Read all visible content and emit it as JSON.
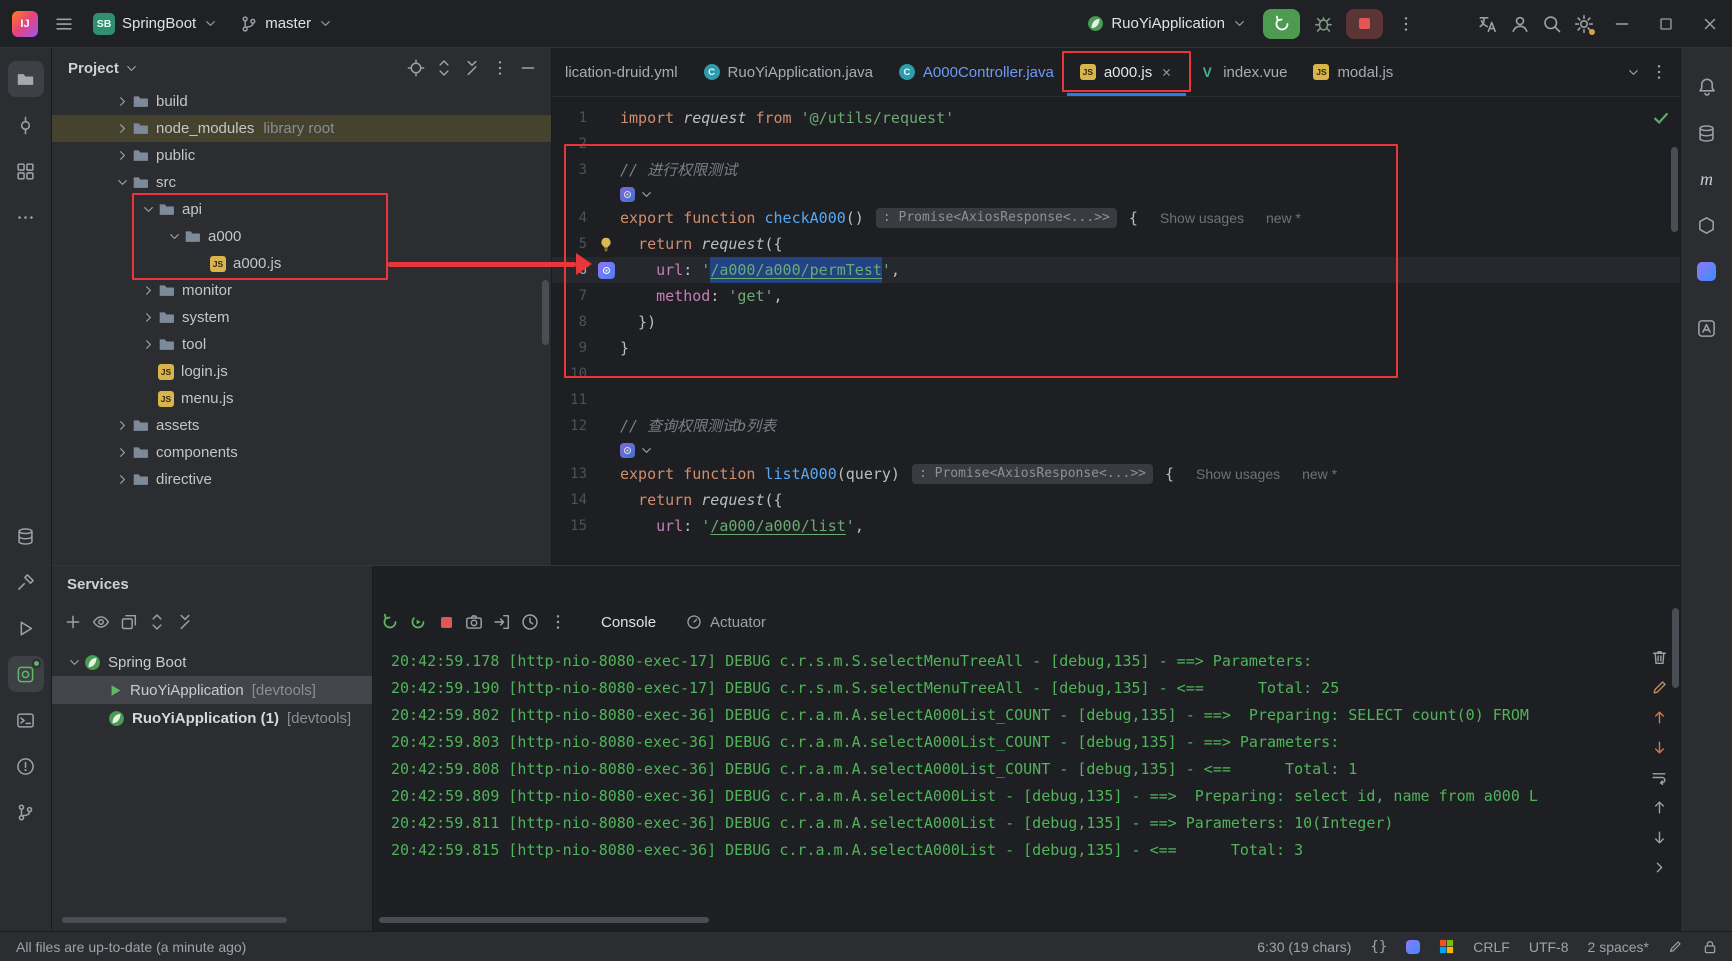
{
  "titlebar": {
    "logo_text": "IJ",
    "project_badge": "SB",
    "project_name": "SpringBoot",
    "branch_name": "master",
    "run_config_name": "RuoYiApplication"
  },
  "icons": {
    "titlebar_right": [
      "translate",
      "user",
      "search",
      "settings",
      "minimize",
      "maximize",
      "close"
    ],
    "left_strip_top": [
      "project",
      "commit",
      "structure",
      "more"
    ],
    "left_strip_bottom": [
      "database",
      "build",
      "run",
      "services",
      "terminal",
      "problems",
      "version-control"
    ],
    "right_strip": [
      "notifications",
      "database",
      "maven",
      "dependencies",
      "ai-plugin",
      "translation"
    ],
    "project_header": [
      "locate",
      "expand-all",
      "collapse-all",
      "kebab",
      "hide"
    ],
    "services_toolbar": [
      "add",
      "show",
      "open-new-tab",
      "expand-all",
      "collapse-all"
    ],
    "console_toolbar": [
      "rerun",
      "restart",
      "stop",
      "camera",
      "open-log",
      "history",
      "kebab"
    ],
    "console_right": [
      "trash",
      "pencil",
      "arrow-up-colored",
      "arrow-down-colored",
      "soft-wrap",
      "arrow-up",
      "arrow-down",
      "chevron-right"
    ]
  },
  "editor_tabs": [
    {
      "label": "lication-druid.yml",
      "icon": "none"
    },
    {
      "label": "RuoYiApplication.java",
      "icon": "class"
    },
    {
      "label": "A000Controller.java",
      "icon": "class",
      "modified": true
    },
    {
      "label": "a000.js",
      "icon": "js",
      "active": true,
      "closable": true
    },
    {
      "label": "index.vue",
      "icon": "vue"
    },
    {
      "label": "modal.js",
      "icon": "js"
    }
  ],
  "project_panel": {
    "title": "Project",
    "tree": [
      {
        "indent": 1,
        "chevron": "right",
        "icon": "folder",
        "label": "build"
      },
      {
        "indent": 1,
        "chevron": "right",
        "icon": "folder",
        "label": "node_modules",
        "suffix": "library root",
        "highlight": true
      },
      {
        "indent": 1,
        "chevron": "right",
        "icon": "folder",
        "label": "public"
      },
      {
        "indent": 1,
        "chevron": "down",
        "icon": "folder",
        "label": "src"
      },
      {
        "indent": 2,
        "chevron": "down",
        "icon": "folder",
        "label": "api"
      },
      {
        "indent": 3,
        "chevron": "down",
        "icon": "folder",
        "label": "a000"
      },
      {
        "indent": 4,
        "chevron": "none",
        "icon": "js",
        "label": "a000.js"
      },
      {
        "indent": 2,
        "chevron": "right",
        "icon": "folder",
        "label": "monitor"
      },
      {
        "indent": 2,
        "chevron": "right",
        "icon": "folder",
        "label": "system"
      },
      {
        "indent": 2,
        "chevron": "right",
        "icon": "folder",
        "label": "tool"
      },
      {
        "indent": 2,
        "chevron": "none",
        "icon": "js",
        "label": "login.js"
      },
      {
        "indent": 2,
        "chevron": "none",
        "icon": "js",
        "label": "menu.js"
      },
      {
        "indent": 1,
        "chevron": "right",
        "icon": "folder",
        "label": "assets"
      },
      {
        "indent": 1,
        "chevron": "right",
        "icon": "folder",
        "label": "components"
      },
      {
        "indent": 1,
        "chevron": "right",
        "icon": "folder",
        "label": "directive"
      }
    ]
  },
  "editor": {
    "rows": [
      {
        "n": 1,
        "segs": [
          [
            "kw",
            "import"
          ],
          [
            "def",
            " "
          ],
          [
            "ital",
            "request"
          ],
          [
            "def",
            " "
          ],
          [
            "kw",
            "from"
          ],
          [
            "def",
            " "
          ],
          [
            "str",
            "'@/utils/request'"
          ]
        ]
      },
      {
        "n": 2,
        "segs": []
      },
      {
        "n": 3,
        "segs": [
          [
            "cmt",
            "// 进行权限测试"
          ]
        ]
      },
      {
        "type": "actions"
      },
      {
        "n": 4,
        "segs": [
          [
            "kw",
            "export"
          ],
          [
            "def",
            " "
          ],
          [
            "kw",
            "function"
          ],
          [
            "def",
            " "
          ],
          [
            "fn",
            "checkA000"
          ],
          [
            "def",
            "() "
          ],
          [
            "pill",
            ": Promise<AxiosResponse<...>>"
          ],
          [
            "def",
            " {"
          ],
          [
            "hint",
            "Show usages"
          ],
          [
            "hint",
            "new *"
          ]
        ]
      },
      {
        "n": 5,
        "bulb": true,
        "segs": [
          [
            "def",
            "  "
          ],
          [
            "kw",
            "return"
          ],
          [
            "def",
            " "
          ],
          [
            "ital",
            "request"
          ],
          [
            "def",
            "({"
          ]
        ]
      },
      {
        "n": 6,
        "current": true,
        "gicon": "endpoint",
        "segs": [
          [
            "def",
            "    "
          ],
          [
            "prop",
            "url"
          ],
          [
            "def",
            ": "
          ],
          [
            "str",
            "'"
          ],
          [
            "sel",
            "/a000/a000/permTest"
          ],
          [
            "str",
            "'"
          ],
          [
            "def",
            ","
          ]
        ]
      },
      {
        "n": 7,
        "segs": [
          [
            "def",
            "    "
          ],
          [
            "prop",
            "method"
          ],
          [
            "def",
            ": "
          ],
          [
            "str",
            "'get'"
          ],
          [
            "def",
            ","
          ]
        ]
      },
      {
        "n": 8,
        "segs": [
          [
            "def",
            "  })"
          ]
        ]
      },
      {
        "n": 9,
        "segs": [
          [
            "def",
            "}"
          ]
        ]
      },
      {
        "n": 10,
        "segs": []
      },
      {
        "n": 11,
        "segs": []
      },
      {
        "n": 12,
        "segs": [
          [
            "cmt",
            "// 查询权限测试b列表"
          ]
        ]
      },
      {
        "type": "actions"
      },
      {
        "n": 13,
        "segs": [
          [
            "kw",
            "export"
          ],
          [
            "def",
            " "
          ],
          [
            "kw",
            "function"
          ],
          [
            "def",
            " "
          ],
          [
            "fn",
            "listA000"
          ],
          [
            "def",
            "(query) "
          ],
          [
            "pill",
            ": Promise<AxiosResponse<...>>"
          ],
          [
            "def",
            " {"
          ],
          [
            "hint",
            "Show usages"
          ],
          [
            "hint",
            "new *"
          ]
        ]
      },
      {
        "n": 14,
        "segs": [
          [
            "def",
            "  "
          ],
          [
            "kw",
            "return"
          ],
          [
            "def",
            " "
          ],
          [
            "ital",
            "request"
          ],
          [
            "def",
            "({"
          ]
        ]
      },
      {
        "n": 15,
        "segs": [
          [
            "def",
            "    "
          ],
          [
            "prop",
            "url"
          ],
          [
            "def",
            ": "
          ],
          [
            "str",
            "'"
          ],
          [
            "link",
            "/a000/a000/list"
          ],
          [
            "str",
            "'"
          ],
          [
            "def",
            ","
          ]
        ]
      }
    ]
  },
  "services": {
    "title": "Services",
    "tree": [
      {
        "indent": 0,
        "chevron": "down",
        "icon": "leaf",
        "label": "Spring Boot"
      },
      {
        "indent": 1,
        "icon": "run-green",
        "label": "RuoYiApplication",
        "suffix": "[devtools]",
        "selected": true,
        "strong": false
      },
      {
        "indent": 1,
        "icon": "leaf",
        "label": "RuoYiApplication (1)",
        "suffix": "[devtools]",
        "strong": true
      }
    ]
  },
  "console": {
    "tabs": [
      {
        "label": "Console",
        "active": true
      },
      {
        "label": "Actuator",
        "icon": "gauge"
      }
    ],
    "lines": [
      "20:42:59.178 [http-nio-8080-exec-17] DEBUG c.r.s.m.S.selectMenuTreeAll - [debug,135] - ==> Parameters:",
      "20:42:59.190 [http-nio-8080-exec-17] DEBUG c.r.s.m.S.selectMenuTreeAll - [debug,135] - <==      Total: 25",
      "20:42:59.802 [http-nio-8080-exec-36] DEBUG c.r.a.m.A.selectA000List_COUNT - [debug,135] - ==>  Preparing: SELECT count(0) FROM",
      "20:42:59.803 [http-nio-8080-exec-36] DEBUG c.r.a.m.A.selectA000List_COUNT - [debug,135] - ==> Parameters:",
      "20:42:59.808 [http-nio-8080-exec-36] DEBUG c.r.a.m.A.selectA000List_COUNT - [debug,135] - <==      Total: 1",
      "20:42:59.809 [http-nio-8080-exec-36] DEBUG c.r.a.m.A.selectA000List - [debug,135] - ==>  Preparing: select id, name from a000 L",
      "20:42:59.811 [http-nio-8080-exec-36] DEBUG c.r.a.m.A.selectA000List - [debug,135] - ==> Parameters: 10(Integer)",
      "20:42:59.815 [http-nio-8080-exec-36] DEBUG c.r.a.m.A.selectA000List - [debug,135] - <==      Total: 3"
    ]
  },
  "status_bar": {
    "left": "All files are up-to-date (a minute ago)",
    "cursor": "6:30 (19 chars)",
    "line_ending": "CRLF",
    "encoding": "UTF-8",
    "indent": "2 spaces*"
  },
  "annotations": {
    "color": "#e8363c",
    "boxes": [
      "active-editor-tab",
      "project-tree-api-a000-files",
      "editor-code-block-lines-3-9"
    ],
    "arrow": "from project tree a000.js to editor line 6"
  },
  "colors": {
    "accent": "#3574f0",
    "console_green": "#50b45a",
    "annotation_red": "#e8363c",
    "editor_bg": "#1e1f22",
    "panel_bg": "#2b2d30"
  }
}
